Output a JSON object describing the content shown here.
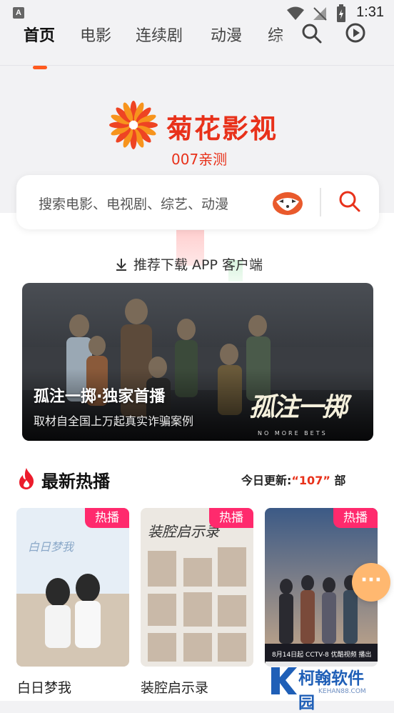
{
  "status_bar": {
    "badge": "A",
    "time": "1:31"
  },
  "nav": {
    "tabs": [
      "首页",
      "电影",
      "连续剧",
      "动漫",
      "综"
    ],
    "active_tab": "首页"
  },
  "brand": {
    "name": "菊花影视",
    "tagline": "007亲测",
    "accent": "#e8311a"
  },
  "search": {
    "placeholder": "搜索电影、电视剧、综艺、动漫"
  },
  "download": {
    "label": "推荐下载 APP 客户端"
  },
  "banner": {
    "title": "孤注一掷·独家首播",
    "subtitle": "取材自全国上万起真实诈骗案例",
    "poster_title": "孤注一掷",
    "poster_en": "NO MORE BETS"
  },
  "section": {
    "title": "最新热播",
    "update_label": "今日更新:",
    "update_count": "“107”",
    "update_unit": "部"
  },
  "cards": [
    {
      "title": "白日梦我",
      "badge": "热播"
    },
    {
      "title": "装腔启示录",
      "badge": "热播"
    },
    {
      "title": "",
      "badge": "热播",
      "poster_caption": "8月14日起 CCTV-8 优酷视频 播出"
    }
  ],
  "watermark": {
    "name": "柯翰软件园",
    "url": "KEHAN88.COM"
  },
  "floating_button": {
    "label": "···"
  }
}
